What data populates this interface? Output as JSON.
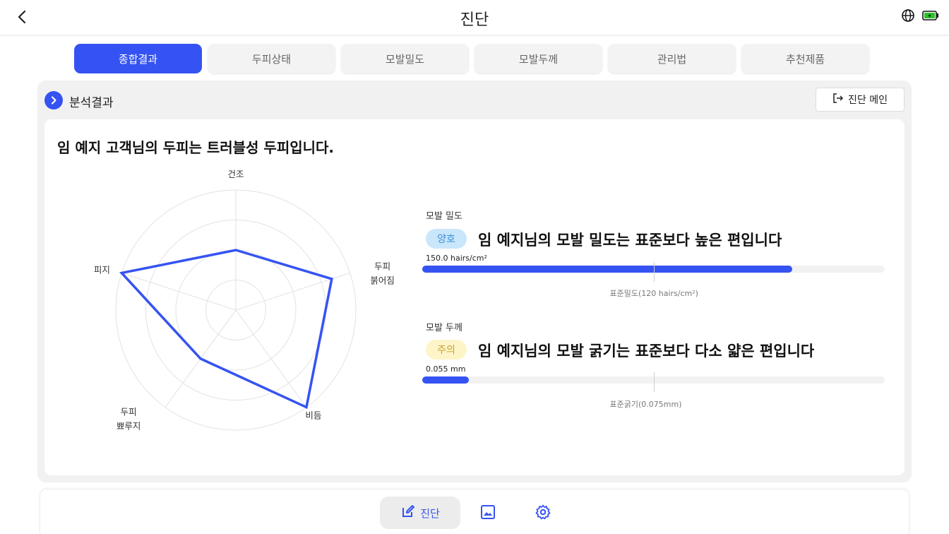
{
  "header": {
    "title": "진단"
  },
  "tabs": [
    {
      "label": "종합결과",
      "active": true
    },
    {
      "label": "두피상태",
      "active": false
    },
    {
      "label": "모발밀도",
      "active": false
    },
    {
      "label": "모발두께",
      "active": false
    },
    {
      "label": "관리법",
      "active": false
    },
    {
      "label": "추천제품",
      "active": false
    }
  ],
  "panel": {
    "title": "분석결과",
    "main_button": "진단 메인",
    "headline": "임 예지 고객님의 두피는 트러블성 두피입니다."
  },
  "radar": {
    "axes": [
      "건조",
      "두피\n붉어짐",
      "비듬",
      "두피\n뾰루지",
      "피지"
    ],
    "axis_lines": [
      [
        "건조"
      ],
      [
        "두피",
        "붉어짐"
      ],
      [
        "비듬"
      ],
      [
        "두피",
        "뾰루지"
      ],
      [
        "피지"
      ]
    ],
    "values": [
      0.5,
      0.84,
      1.0,
      0.5,
      1.0
    ],
    "rings": 4,
    "color": "#3553f2"
  },
  "density": {
    "label": "모발 밀도",
    "badge": "양호",
    "text": "임 예지님의 모발 밀도는 표준보다 높은 편입니다",
    "value": "150.0 hairs/cm²",
    "fill_fraction": 0.8,
    "standard_fraction": 0.5,
    "standard_text": "표준밀도(120 hairs/cm²)"
  },
  "thickness": {
    "label": "모발 두께",
    "badge": "주의",
    "text": "임 예지님의 모발 굵기는 표준보다 다소 얇은 편입니다",
    "value": "0.055 mm",
    "fill_fraction": 0.1,
    "standard_fraction": 0.5,
    "standard_text": "표준굵기(0.075mm)"
  },
  "bottom_nav": {
    "diagnosis_label": "진단",
    "accent": "#3553f2"
  }
}
